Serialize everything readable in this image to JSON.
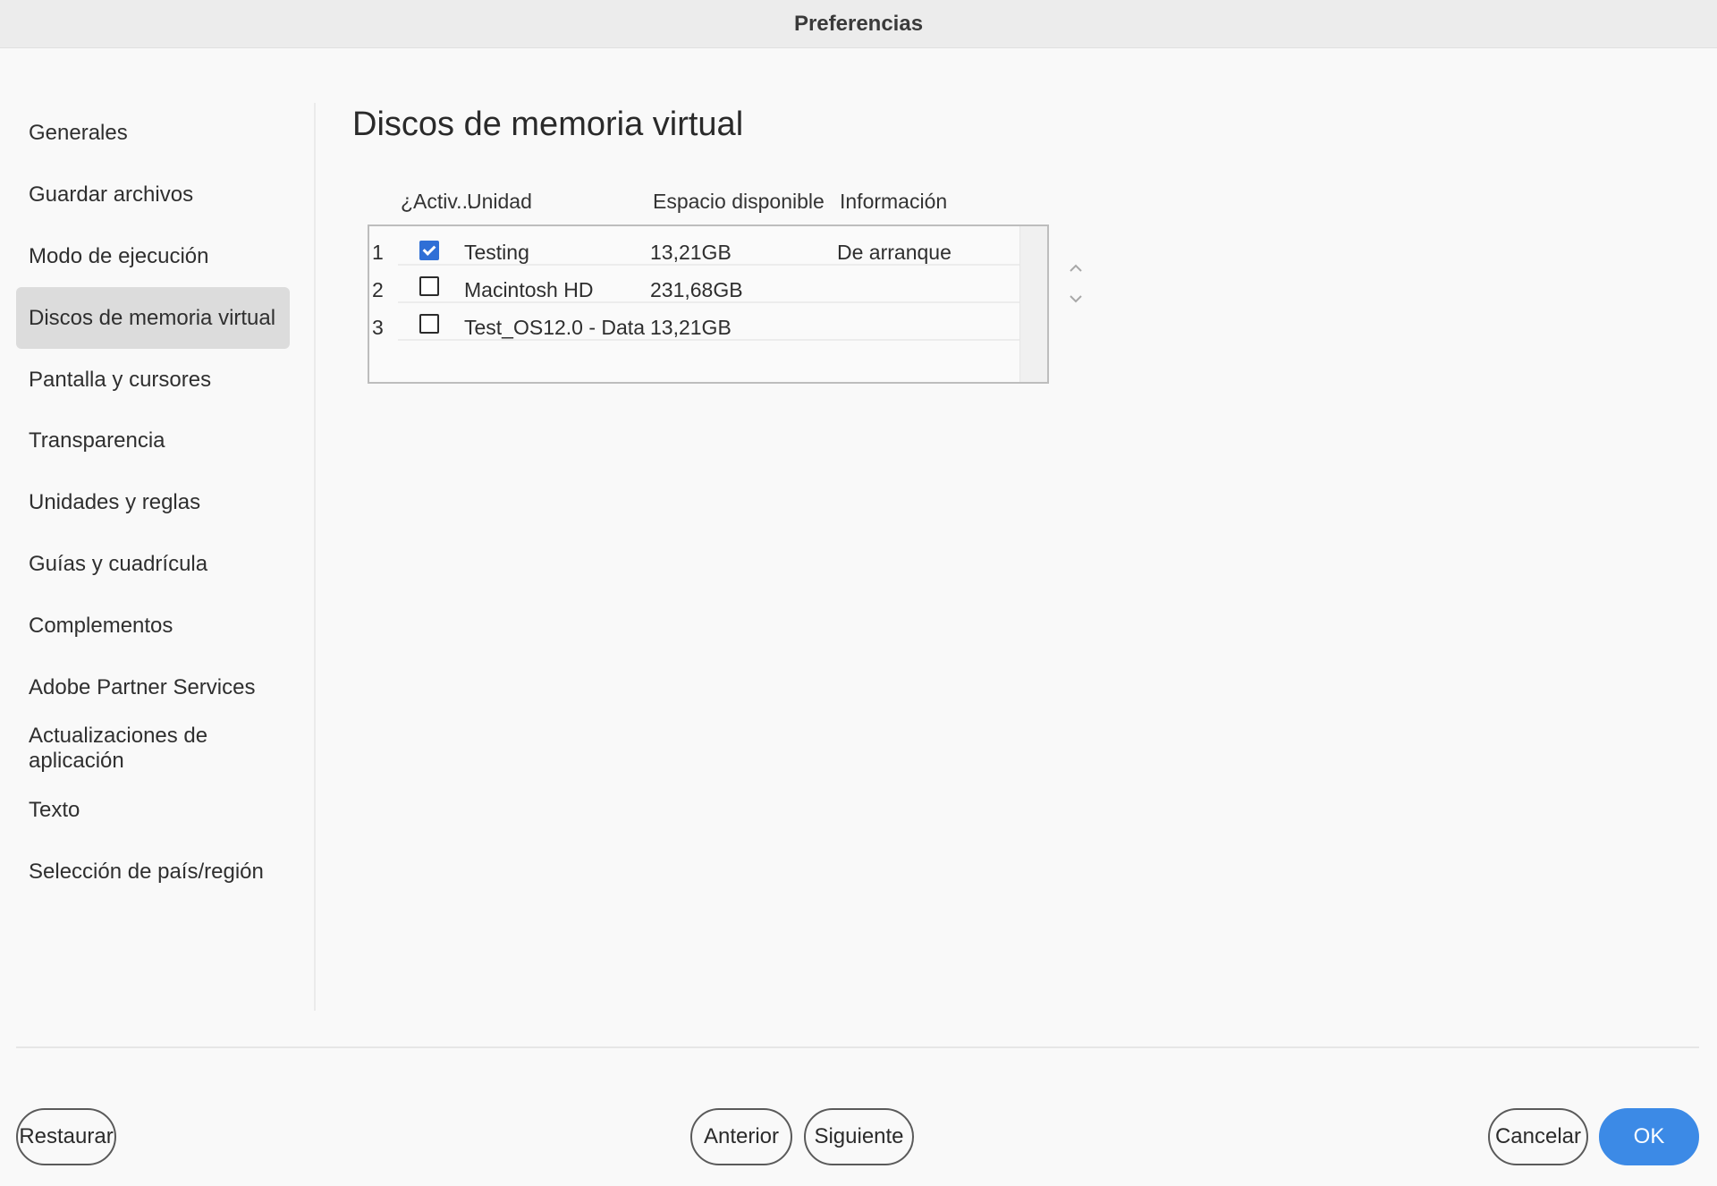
{
  "window": {
    "title": "Preferencias"
  },
  "sidebar": {
    "items": [
      {
        "label": "Generales",
        "active": false
      },
      {
        "label": "Guardar archivos",
        "active": false
      },
      {
        "label": "Modo de ejecución",
        "active": false
      },
      {
        "label": "Discos de memoria virtual",
        "active": true
      },
      {
        "label": "Pantalla y cursores",
        "active": false
      },
      {
        "label": "Transparencia",
        "active": false
      },
      {
        "label": "Unidades y reglas",
        "active": false
      },
      {
        "label": "Guías y cuadrícula",
        "active": false
      },
      {
        "label": "Complementos",
        "active": false
      },
      {
        "label": "Adobe Partner Services",
        "active": false
      },
      {
        "label": "Actualizaciones de aplicación",
        "active": false
      },
      {
        "label": "Texto",
        "active": false
      },
      {
        "label": "Selección de país/región",
        "active": false
      }
    ]
  },
  "main": {
    "title": "Discos de memoria virtual",
    "table": {
      "headers": {
        "active": "¿Activ...",
        "unit": "Unidad",
        "space": "Espacio disponible",
        "info": "Información"
      },
      "rows": [
        {
          "index": "1",
          "checked": true,
          "unit": "Testing",
          "space": "13,21GB",
          "info": "De arranque"
        },
        {
          "index": "2",
          "checked": false,
          "unit": "Macintosh HD",
          "space": "231,68GB",
          "info": ""
        },
        {
          "index": "3",
          "checked": false,
          "unit": "Test_OS12.0 - Data",
          "space": "13,21GB",
          "info": ""
        }
      ]
    },
    "move_up_icon": "chevron-up-icon",
    "move_down_icon": "chevron-down-icon"
  },
  "footer": {
    "restore_label": "Restaurar",
    "previous_label": "Anterior",
    "next_label": "Siguiente",
    "cancel_label": "Cancelar",
    "ok_label": "OK"
  },
  "colors": {
    "accent": "#3c8ae6",
    "checkbox_checked": "#2f6fd6",
    "active_sidebar": "#dcdcdc"
  }
}
